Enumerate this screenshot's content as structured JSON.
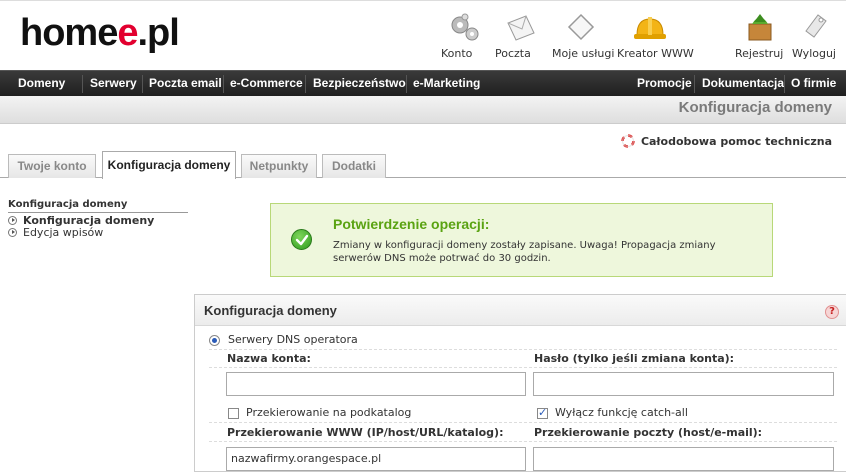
{
  "header": {
    "logo_main": "home",
    "logo_accent": "e",
    "logo_tail": ".pl",
    "icons": [
      {
        "label": "Konto",
        "icon": "gears-icon"
      },
      {
        "label": "Poczta",
        "icon": "mail-icon"
      },
      {
        "label": "Moje usługi",
        "icon": "services-icon"
      },
      {
        "label": "Kreator WWW",
        "icon": "hardhat-icon"
      },
      {
        "label": "Rejestruj",
        "icon": "register-icon"
      },
      {
        "label": "Wyloguj",
        "icon": "logout-icon"
      }
    ]
  },
  "nav": {
    "left": [
      "Domeny",
      "Serwery",
      "Poczta email",
      "e-Commerce",
      "Bezpieczeństwo",
      "e-Marketing"
    ],
    "right": [
      "Promocje",
      "Dokumentacja",
      "O firmie"
    ]
  },
  "title": "Konfiguracja domeny",
  "help_link": "Całodobowa pomoc techniczna",
  "tabs": [
    "Twoje konto",
    "Konfiguracja domeny",
    "Netpunkty",
    "Dodatki"
  ],
  "side": {
    "heading": "Konfiguracja domeny",
    "items": [
      "Konfiguracja domeny",
      "Edycja wpisów"
    ]
  },
  "success": {
    "title": "Potwierdzenie operacji:",
    "message": "Zmiany w konfiguracji domeny zostały zapisane. Uwaga! Propagacja zmiany serwerów DNS może potrwać do 30 godzin."
  },
  "panel": {
    "title": "Konfiguracja domeny",
    "help": "?",
    "radio_dns": "Serwery DNS operatora",
    "account_label": "Nazwa konta:",
    "account_value": "",
    "password_label": "Hasło (tylko jeśli zmiana konta):",
    "password_value": "",
    "redirect_subdir": "Przekierowanie na podkatalog",
    "catch_all": "Wyłącz funkcję catch-all",
    "www_label": "Przekierowanie WWW (IP/host/URL/katalog):",
    "www_value": "nazwafirmy.orangespace.pl",
    "mail_label": "Przekierowanie poczty (host/e-mail):",
    "mail_value": ""
  },
  "colors": {
    "accent": "#e2002f",
    "success_title": "#5aa312",
    "nav_bg": "#2a2a2a"
  }
}
